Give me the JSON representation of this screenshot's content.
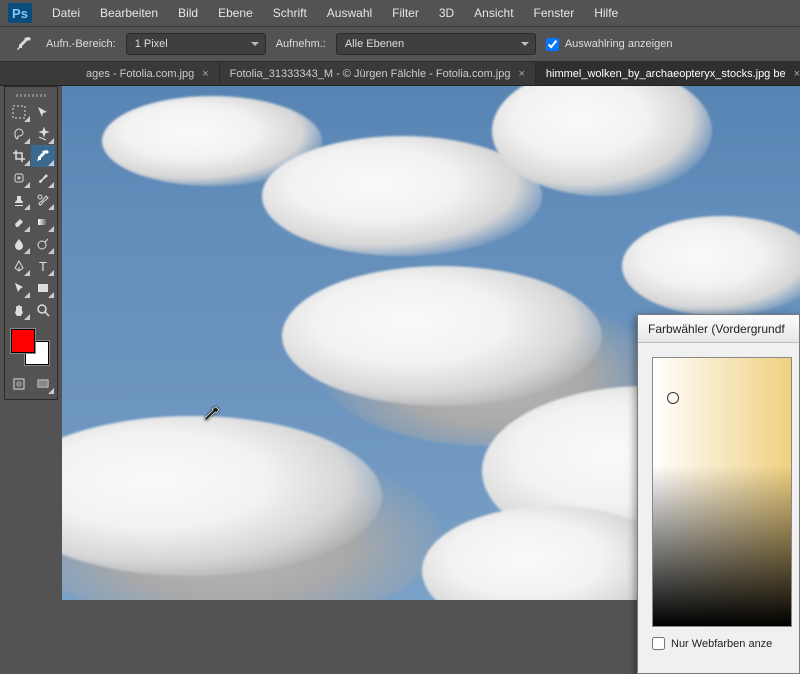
{
  "app": {
    "logo": "Ps"
  },
  "menu": [
    "Datei",
    "Bearbeiten",
    "Bild",
    "Ebene",
    "Schrift",
    "Auswahl",
    "Filter",
    "3D",
    "Ansicht",
    "Fenster",
    "Hilfe"
  ],
  "options": {
    "sample_label": "Aufn.-Bereich:",
    "sample_value": "1 Pixel",
    "sample_from_label": "Aufnehm.:",
    "sample_from_value": "Alle Ebenen",
    "show_ring_label": "Auswahlring anzeigen",
    "show_ring_checked": true
  },
  "tabs": [
    {
      "label": "ages - Fotolia.com.jpg",
      "active": false
    },
    {
      "label": "Fotolia_31333343_M - © Jürgen Fälchle - Fotolia.com.jpg",
      "active": false
    },
    {
      "label": "himmel_wolken_by_archaeopteryx_stocks.jpg be",
      "active": true
    }
  ],
  "swatches": {
    "foreground": "#ff0000",
    "background": "#ffffff"
  },
  "picker": {
    "title": "Farbwähler (Vordergrundf",
    "webonly_label": "Nur Webfarben anze",
    "webonly_checked": false
  },
  "tools": [
    [
      "marquee",
      "move"
    ],
    [
      "lasso",
      "magic-wand"
    ],
    [
      "crop",
      "eyedropper"
    ],
    [
      "healing",
      "brush"
    ],
    [
      "stamp",
      "history-brush"
    ],
    [
      "eraser",
      "gradient"
    ],
    [
      "blur",
      "dodge"
    ],
    [
      "pen",
      "type"
    ],
    [
      "path-select",
      "rectangle"
    ],
    [
      "hand",
      "zoom"
    ]
  ],
  "selected_tool": "eyedropper"
}
